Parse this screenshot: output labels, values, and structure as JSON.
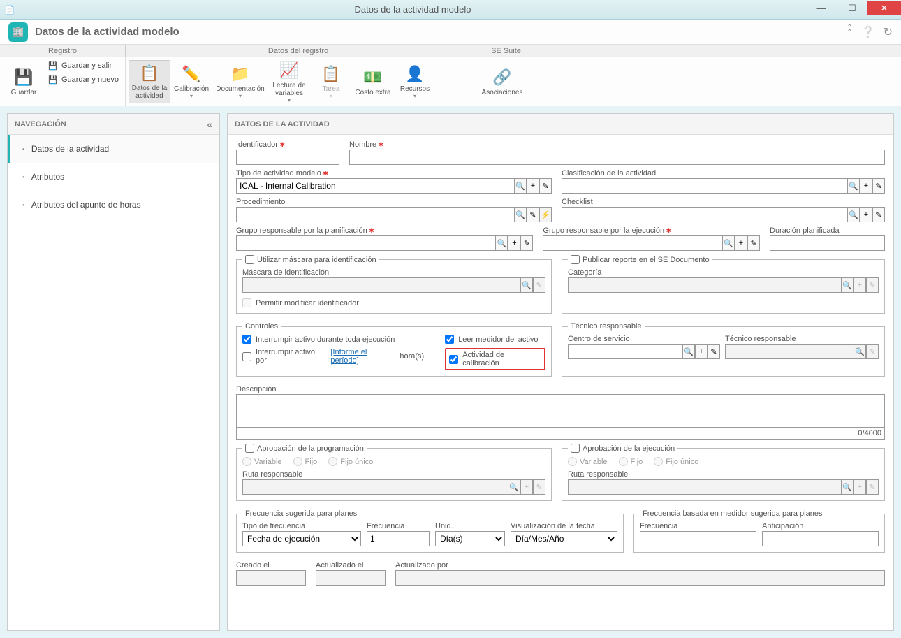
{
  "window": {
    "title": "Datos de la actividad modelo"
  },
  "subtitle": {
    "title": "Datos de la actividad modelo"
  },
  "tabheads": {
    "t1": "Registro",
    "t2": "Datos del registro",
    "t3": "SE Suite"
  },
  "ribbon": {
    "guardar": "Guardar",
    "guardar_salir": "Guardar y salir",
    "guardar_nuevo": "Guardar y nuevo",
    "datos_actividad": "Datos de la\nactividad",
    "calibracion": "Calibración",
    "documentacion": "Documentación",
    "lectura_variables": "Lectura de\nvariables",
    "tarea": "Tarea",
    "costo_extra": "Costo extra",
    "recursos": "Recursos",
    "asociaciones": "Asociaciones"
  },
  "nav": {
    "header": "NAVEGACIÓN",
    "items": [
      "Datos de la actividad",
      "Atributos",
      "Atributos del apunte de horas"
    ]
  },
  "content_header": "DATOS DE LA ACTIVIDAD",
  "fields": {
    "identificador": "Identificador",
    "nombre": "Nombre",
    "tipo_actividad": "Tipo de actividad modelo",
    "tipo_actividad_value": "ICAL - Internal Calibration",
    "clasificacion": "Clasificación de la actividad",
    "procedimiento": "Procedimiento",
    "checklist": "Checklist",
    "grupo_planif": "Grupo responsable por la planificación",
    "grupo_ejec": "Grupo responsable por la ejecución",
    "duracion": "Duración planificada",
    "mascara_title": "Utilizar máscara para identificación",
    "mascara": "Máscara de identificación",
    "permitir_modificar": "Permitir modificar identificador",
    "publicar_title": "Publicar reporte en el SE Documento",
    "categoria": "Categoría",
    "controles": "Controles",
    "interrumpir_toda": "Interrumpir activo durante toda ejecución",
    "interrumpir_por": "Interrumpir activo por",
    "informe_periodo": "[Informe el período]",
    "horas": "hora(s)",
    "leer_medidor": "Leer medidor del activo",
    "actividad_cal": "Actividad de calibración",
    "tecnico_title": "Técnico responsable",
    "centro_servicio": "Centro de servicio",
    "tecnico_resp": "Técnico responsable",
    "descripcion": "Descripción",
    "counter": "0/4000",
    "aprob_prog": "Aprobación de la programación",
    "aprob_ejec": "Aprobación de la ejecución",
    "variable": "Variable",
    "fijo": "Fijo",
    "fijo_unico": "Fijo único",
    "ruta": "Ruta responsable",
    "freq_sug": "Frecuencia sugerida para planes",
    "tipo_freq": "Tipo de frecuencia",
    "tipo_freq_value": "Fecha de ejecución",
    "frecuencia": "Frecuencia",
    "frecuencia_value": "1",
    "unid": "Unid.",
    "unid_value": "Día(s)",
    "visualizacion": "Visualización de la fecha",
    "visualizacion_value": "Día/Mes/Año",
    "freq_medidor": "Frecuencia basada en medidor sugerida para planes",
    "anticipacion": "Anticipación",
    "creado": "Creado el",
    "actualizado": "Actualizado el",
    "actualizado_por": "Actualizado por"
  }
}
